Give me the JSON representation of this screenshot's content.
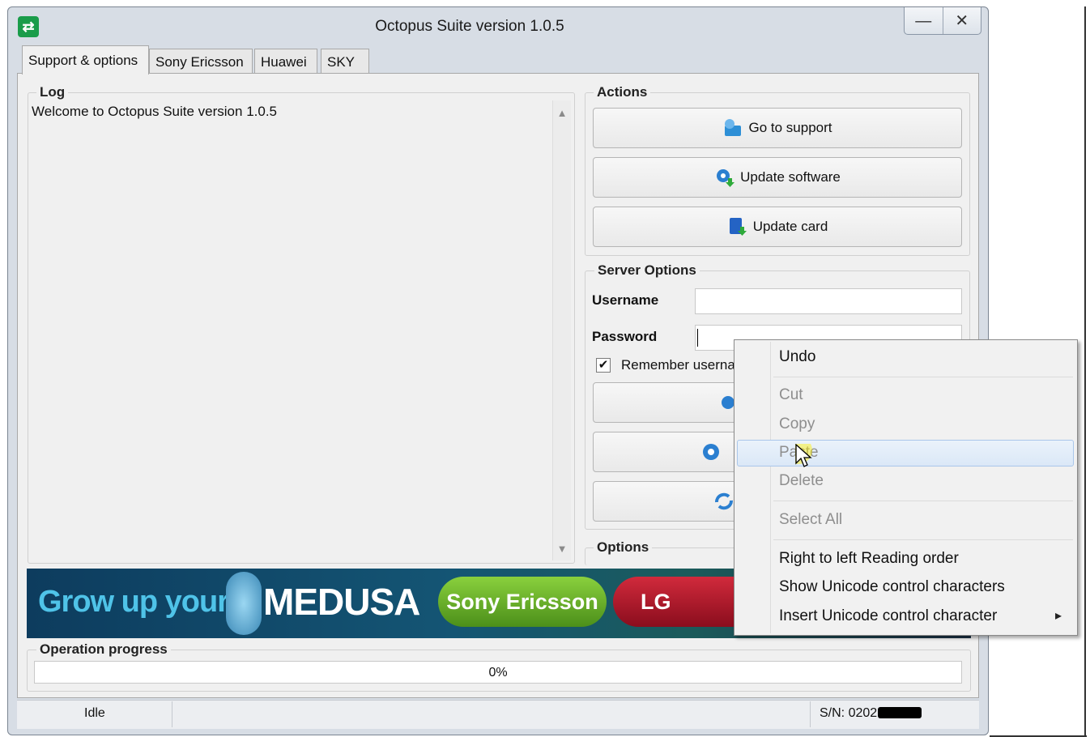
{
  "window": {
    "title": "Octopus Suite version 1.0.5",
    "minimize": "—",
    "close": "✕"
  },
  "tabs": [
    "Support & options",
    "Sony Ericsson",
    "Huawei",
    "SKY"
  ],
  "log": {
    "label": "Log",
    "text": "Welcome to Octopus Suite version 1.0.5"
  },
  "actions": {
    "label": "Actions",
    "buttons": [
      "Go to support",
      "Update software",
      "Update card"
    ]
  },
  "server_options": {
    "label": "Server Options",
    "username_label": "Username",
    "username_value": "",
    "password_label": "Password",
    "password_value": "",
    "remember_label": "Remember userna",
    "remember_checked": true
  },
  "options": {
    "label": "Options"
  },
  "banner": {
    "text": "Grow up your",
    "brand": "MEDUSA",
    "pill1": "Sony Ericsson",
    "pill2": "LG"
  },
  "progress": {
    "label": "Operation progress",
    "value_text": "0%",
    "value": 0
  },
  "status": {
    "state": "Idle",
    "serial": "S/N: 0202"
  },
  "context_menu": {
    "items": [
      {
        "label": "Undo",
        "enabled": true
      },
      {
        "label": "Cut",
        "enabled": false
      },
      {
        "label": "Copy",
        "enabled": false
      },
      {
        "label": "Paste",
        "enabled": false,
        "hovered": true
      },
      {
        "label": "Delete",
        "enabled": false
      },
      {
        "label": "Select All",
        "enabled": false
      },
      {
        "label": "Right to left Reading order",
        "enabled": true
      },
      {
        "label": "Show Unicode control characters",
        "enabled": true
      },
      {
        "label": "Insert Unicode control character",
        "enabled": true,
        "submenu": true
      }
    ],
    "submenu_arrow": "▸"
  },
  "colors": {
    "window_frame": "#d7dde5",
    "client_bg": "#f0f0f0",
    "banner_dark": "#0d3c5e",
    "banner_text": "#4fc3e8",
    "pill_green": "#5aa423",
    "pill_red": "#b51628",
    "menu_highlight": "#dbe8f7"
  }
}
